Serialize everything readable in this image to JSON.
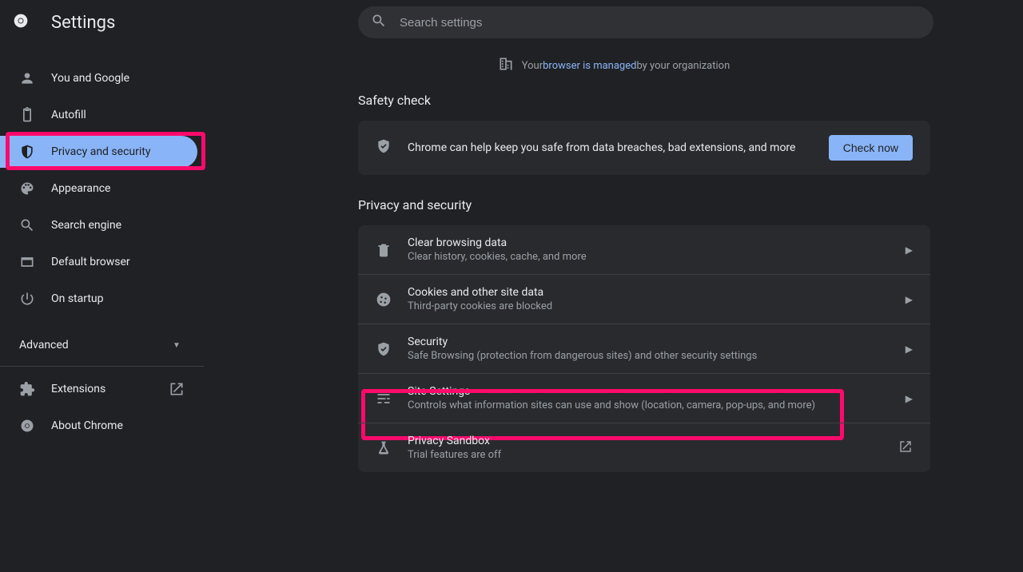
{
  "header": {
    "title": "Settings",
    "search_placeholder": "Search settings"
  },
  "managed_banner": {
    "prefix": "Your ",
    "link": "browser is managed",
    "suffix": " by your organization"
  },
  "sidebar": {
    "items": [
      {
        "id": "you-and-google",
        "label": "You and Google",
        "icon": "person-icon"
      },
      {
        "id": "autofill",
        "label": "Autofill",
        "icon": "clipboard-icon"
      },
      {
        "id": "privacy-security",
        "label": "Privacy and security",
        "icon": "shield-icon",
        "selected": true
      },
      {
        "id": "appearance",
        "label": "Appearance",
        "icon": "palette-icon"
      },
      {
        "id": "search-engine",
        "label": "Search engine",
        "icon": "search-icon"
      },
      {
        "id": "default-browser",
        "label": "Default browser",
        "icon": "browser-icon"
      },
      {
        "id": "on-startup",
        "label": "On startup",
        "icon": "power-icon"
      }
    ],
    "advanced_label": "Advanced",
    "bottom": [
      {
        "id": "extensions",
        "label": "Extensions",
        "icon": "puzzle-icon",
        "external": true
      },
      {
        "id": "about-chrome",
        "label": "About Chrome",
        "icon": "chrome-icon"
      }
    ]
  },
  "sections": {
    "safety_check": {
      "title": "Safety check",
      "description": "Chrome can help keep you safe from data breaches, bad extensions, and more",
      "button": "Check now"
    },
    "privacy": {
      "title": "Privacy and security",
      "rows": [
        {
          "id": "clear-data",
          "icon": "trash-icon",
          "title": "Clear browsing data",
          "sub": "Clear history, cookies, cache, and more"
        },
        {
          "id": "cookies",
          "icon": "cookie-icon",
          "title": "Cookies and other site data",
          "sub": "Third-party cookies are blocked"
        },
        {
          "id": "security",
          "icon": "shield-check-icon",
          "title": "Security",
          "sub": "Safe Browsing (protection from dangerous sites) and other security settings"
        },
        {
          "id": "site-settings",
          "icon": "tune-icon",
          "title": "Site Settings",
          "sub": "Controls what information sites can use and show (location, camera, pop-ups, and more)"
        },
        {
          "id": "privacy-sandbox",
          "icon": "flask-icon",
          "title": "Privacy Sandbox",
          "sub": "Trial features are off",
          "external": true
        }
      ]
    }
  }
}
